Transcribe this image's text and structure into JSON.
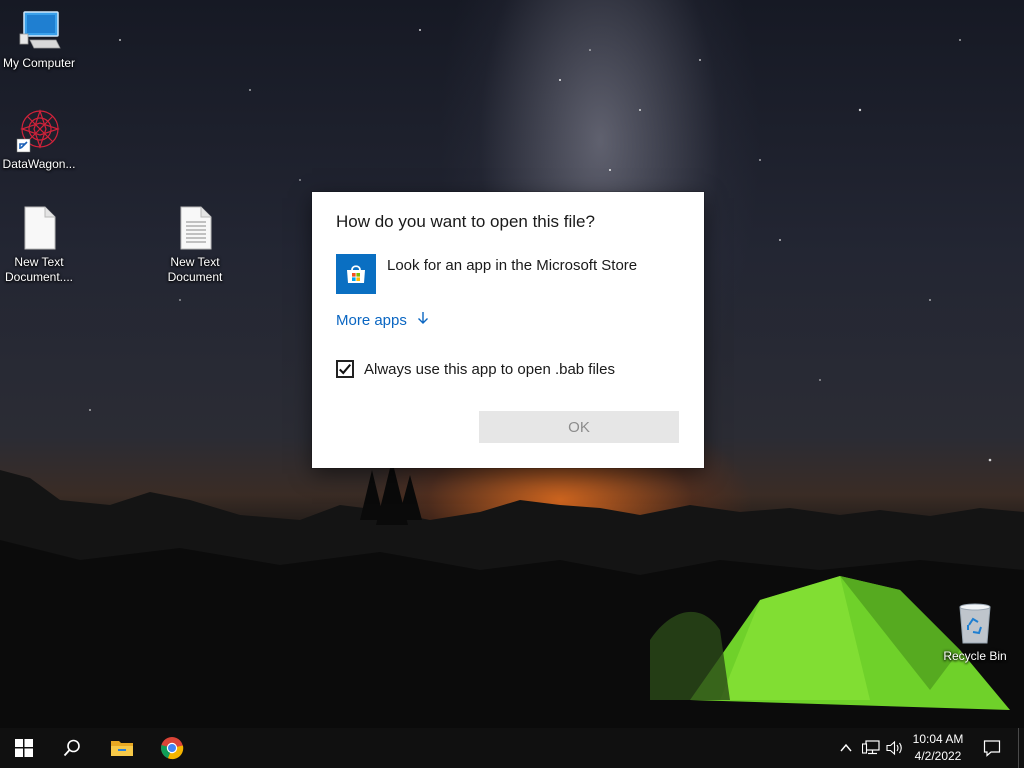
{
  "desktop": {
    "icons": [
      {
        "label": "My Computer"
      },
      {
        "label": "DataWagon..."
      },
      {
        "label": "New Text Document...."
      },
      {
        "label": "New Text Document"
      },
      {
        "label": "Recycle Bin"
      }
    ]
  },
  "dialog": {
    "title": "How do you want to open this file?",
    "store_option": "Look for an app in the Microsoft Store",
    "more_apps": "More apps",
    "more_apps_icon": "arrow-down-icon",
    "checkbox_label": "Always use this app to open .bab files",
    "checkbox_checked": true,
    "ok_label": "OK"
  },
  "taskbar": {
    "pinned": [
      "windows-start-icon",
      "search-icon",
      "file-explorer-icon",
      "chrome-icon"
    ],
    "tray": [
      "chevron-up-icon",
      "network-icon",
      "volume-icon"
    ],
    "time": "10:04 AM",
    "date": "4/2/2022",
    "notification_icon": "action-center-icon"
  },
  "colors": {
    "accent": "#0a6fc2",
    "link": "#0a66c2",
    "taskbar": "#101010"
  }
}
